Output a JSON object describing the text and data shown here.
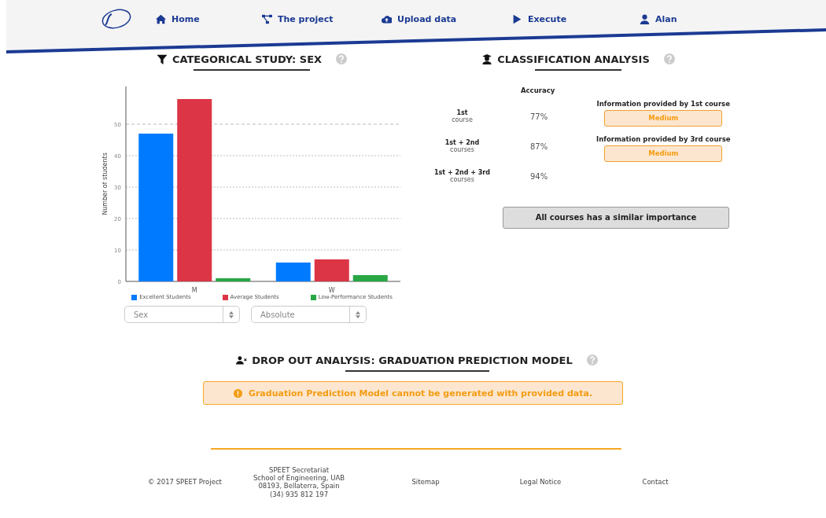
{
  "nav": {
    "items": [
      {
        "label": "Home"
      },
      {
        "label": "The project"
      },
      {
        "label": "Upload data"
      },
      {
        "label": "Execute"
      },
      {
        "label": "Alan"
      }
    ]
  },
  "categorical": {
    "title": "CATEGORICAL STUDY: SEX",
    "chart_data": {
      "type": "bar",
      "ylabel": "Number of students",
      "categories": [
        "M",
        "W"
      ],
      "ylim": [
        0,
        62
      ],
      "yticks": [
        0,
        10,
        20,
        30,
        40,
        50
      ],
      "grid": true,
      "series": [
        {
          "name": "Excellent Students",
          "color": "#007bff",
          "values": [
            47,
            6
          ]
        },
        {
          "name": "Average Students",
          "color": "#dc3545",
          "values": [
            58,
            7
          ]
        },
        {
          "name": "Low-Performance Students",
          "color": "#28a745",
          "values": [
            1,
            2
          ]
        }
      ]
    },
    "selects": [
      {
        "value": "Sex"
      },
      {
        "value": "Absolute"
      }
    ]
  },
  "classification": {
    "title": "CLASSIFICATION ANALYSIS",
    "accuracy_header": "Accuracy",
    "rows": [
      {
        "label": "1st",
        "sub": "course",
        "accuracy": "77%"
      },
      {
        "label": "1st + 2nd",
        "sub": "courses",
        "accuracy": "87%"
      },
      {
        "label": "1st + 2nd + 3rd",
        "sub": "courses",
        "accuracy": "94%"
      }
    ],
    "info": [
      {
        "label": "Information provided by 1st course",
        "value": "Medium"
      },
      {
        "label": "Information provided by 3rd course",
        "value": "Medium"
      }
    ],
    "summary": "All courses has a similar importance"
  },
  "dropout": {
    "title": "DROP OUT ANALYSIS: GRADUATION PREDICTION MODEL",
    "alert": "Graduation Prediction Model cannot be generated with provided data."
  },
  "footer": {
    "copyright": "© 2017 SPEET Project",
    "address": [
      "SPEET Secretariat",
      "School of Engineering, UAB",
      "08193, Bellaterra, Spain",
      "(34) 935 812 197"
    ],
    "links": [
      "Sitemap",
      "Legal Notice",
      "Contact"
    ]
  }
}
